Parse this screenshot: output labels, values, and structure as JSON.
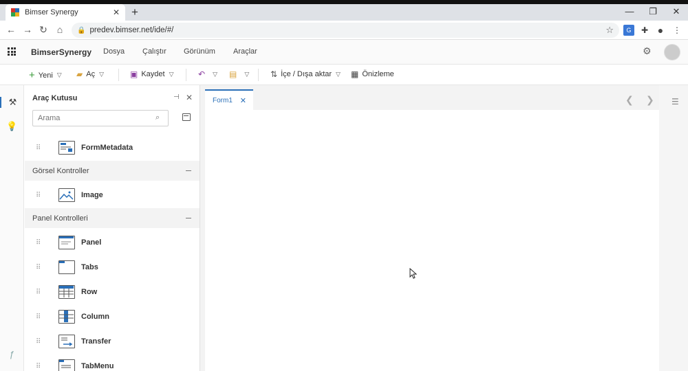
{
  "browser": {
    "tab_title": "Bimser Synergy",
    "url": "predev.bimser.net/ide/#/"
  },
  "app": {
    "brand": "BimserSynergy",
    "menus": [
      "Dosya",
      "Çalıştır",
      "Görünüm",
      "Araçlar"
    ]
  },
  "toolbar": {
    "new_label": "Yeni",
    "open_label": "Aç",
    "save_label": "Kaydet",
    "import_export_label": "İçe / Dışa aktar",
    "preview_label": "Önizleme"
  },
  "toolbox": {
    "title": "Araç Kutusu",
    "search_placeholder": "Arama",
    "top_item": "FormMetadata",
    "sections": [
      {
        "label": "Görsel Kontroller",
        "items": [
          "Image"
        ]
      },
      {
        "label": "Panel Kontrolleri",
        "items": [
          "Panel",
          "Tabs",
          "Row",
          "Column",
          "Transfer",
          "TabMenu"
        ]
      }
    ]
  },
  "editor": {
    "tab_label": "Form1"
  },
  "colors": {
    "accent": "#2a6fb8",
    "save_icon": "#8b3fa0",
    "new_icon": "#3a9b3a",
    "open_icon": "#d9a441"
  }
}
